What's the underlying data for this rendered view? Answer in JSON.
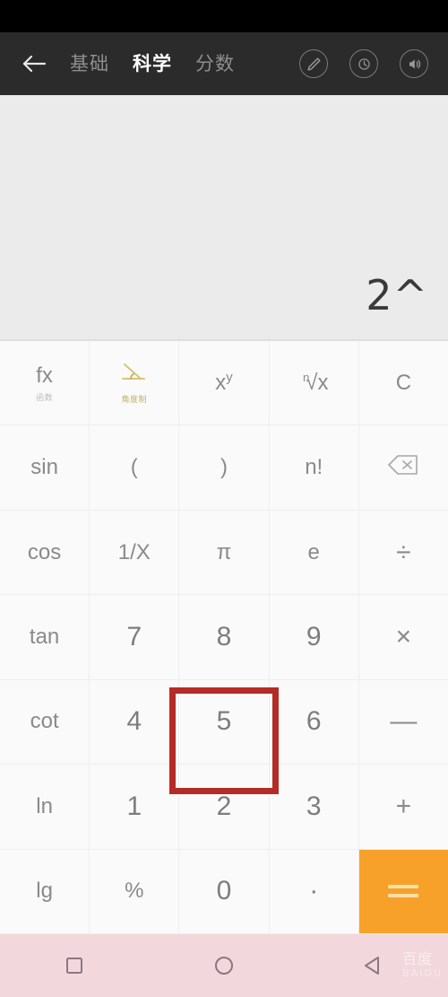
{
  "header": {
    "back_icon": "back-arrow-icon",
    "tabs": [
      {
        "label": "基础",
        "active": false
      },
      {
        "label": "科学",
        "active": true
      },
      {
        "label": "分数",
        "active": false
      }
    ],
    "icons": [
      {
        "name": "pencil-edit-icon"
      },
      {
        "name": "history-icon"
      },
      {
        "name": "sound-speaker-icon"
      }
    ]
  },
  "display": {
    "expression": "2^"
  },
  "keypad": {
    "rows": [
      [
        {
          "name": "key-fx",
          "label": "fx",
          "sub": "函数",
          "kind": "func"
        },
        {
          "name": "key-angle",
          "label": "",
          "sub": "角度制",
          "kind": "icon-angle"
        },
        {
          "name": "key-power",
          "label": "x^y",
          "sub": "",
          "kind": "power"
        },
        {
          "name": "key-nth-root",
          "label": "ⁿ√x",
          "sub": "",
          "kind": "root"
        },
        {
          "name": "key-clear",
          "label": "C",
          "sub": "",
          "kind": "func"
        }
      ],
      [
        {
          "name": "key-sin",
          "label": "sin",
          "sub": "",
          "kind": "func"
        },
        {
          "name": "key-paren-open",
          "label": "(",
          "sub": "",
          "kind": "func"
        },
        {
          "name": "key-paren-close",
          "label": ")",
          "sub": "",
          "kind": "func"
        },
        {
          "name": "key-factorial",
          "label": "n!",
          "sub": "",
          "kind": "func"
        },
        {
          "name": "key-backspace",
          "label": "",
          "sub": "",
          "kind": "icon-backspace"
        }
      ],
      [
        {
          "name": "key-cos",
          "label": "cos",
          "sub": "",
          "kind": "func"
        },
        {
          "name": "key-reciprocal",
          "label": "1/X",
          "sub": "",
          "kind": "func"
        },
        {
          "name": "key-pi",
          "label": "π",
          "sub": "",
          "kind": "func"
        },
        {
          "name": "key-e",
          "label": "e",
          "sub": "",
          "kind": "func"
        },
        {
          "name": "key-divide",
          "label": "÷",
          "sub": "",
          "kind": "op"
        }
      ],
      [
        {
          "name": "key-tan",
          "label": "tan",
          "sub": "",
          "kind": "func"
        },
        {
          "name": "key-7",
          "label": "7",
          "sub": "",
          "kind": "num"
        },
        {
          "name": "key-8",
          "label": "8",
          "sub": "",
          "kind": "num"
        },
        {
          "name": "key-9",
          "label": "9",
          "sub": "",
          "kind": "num"
        },
        {
          "name": "key-multiply",
          "label": "×",
          "sub": "",
          "kind": "op"
        }
      ],
      [
        {
          "name": "key-cot",
          "label": "cot",
          "sub": "",
          "kind": "func"
        },
        {
          "name": "key-4",
          "label": "4",
          "sub": "",
          "kind": "num"
        },
        {
          "name": "key-5",
          "label": "5",
          "sub": "",
          "kind": "num"
        },
        {
          "name": "key-6",
          "label": "6",
          "sub": "",
          "kind": "num"
        },
        {
          "name": "key-minus",
          "label": "—",
          "sub": "",
          "kind": "op"
        }
      ],
      [
        {
          "name": "key-ln",
          "label": "ln",
          "sub": "",
          "kind": "func"
        },
        {
          "name": "key-1",
          "label": "1",
          "sub": "",
          "kind": "num"
        },
        {
          "name": "key-2",
          "label": "2",
          "sub": "",
          "kind": "num"
        },
        {
          "name": "key-3",
          "label": "3",
          "sub": "",
          "kind": "num"
        },
        {
          "name": "key-plus",
          "label": "+",
          "sub": "",
          "kind": "op"
        }
      ],
      [
        {
          "name": "key-lg",
          "label": "lg",
          "sub": "",
          "kind": "func"
        },
        {
          "name": "key-percent",
          "label": "%",
          "sub": "",
          "kind": "func"
        },
        {
          "name": "key-0",
          "label": "0",
          "sub": "",
          "kind": "num"
        },
        {
          "name": "key-decimal",
          "label": "·",
          "sub": "",
          "kind": "num"
        },
        {
          "name": "key-equals",
          "label": "=",
          "sub": "",
          "kind": "equals"
        }
      ]
    ]
  },
  "annotation": {
    "highlight_color": "#b52b25",
    "highlight_target": "key-power"
  },
  "navbar": {
    "buttons": [
      {
        "name": "nav-recents-button",
        "icon": "square-icon"
      },
      {
        "name": "nav-home-button",
        "icon": "circle-icon"
      },
      {
        "name": "nav-back-button",
        "icon": "triangle-back-icon"
      }
    ],
    "watermark": "百度",
    "watermark_sub": "BAIDU"
  },
  "colors": {
    "header_bg": "#2b2b2b",
    "display_bg": "#ebebeb",
    "keypad_bg": "#fafafa",
    "accent_orange": "#f7a12a",
    "navbar_bg": "#f2d8dd"
  }
}
